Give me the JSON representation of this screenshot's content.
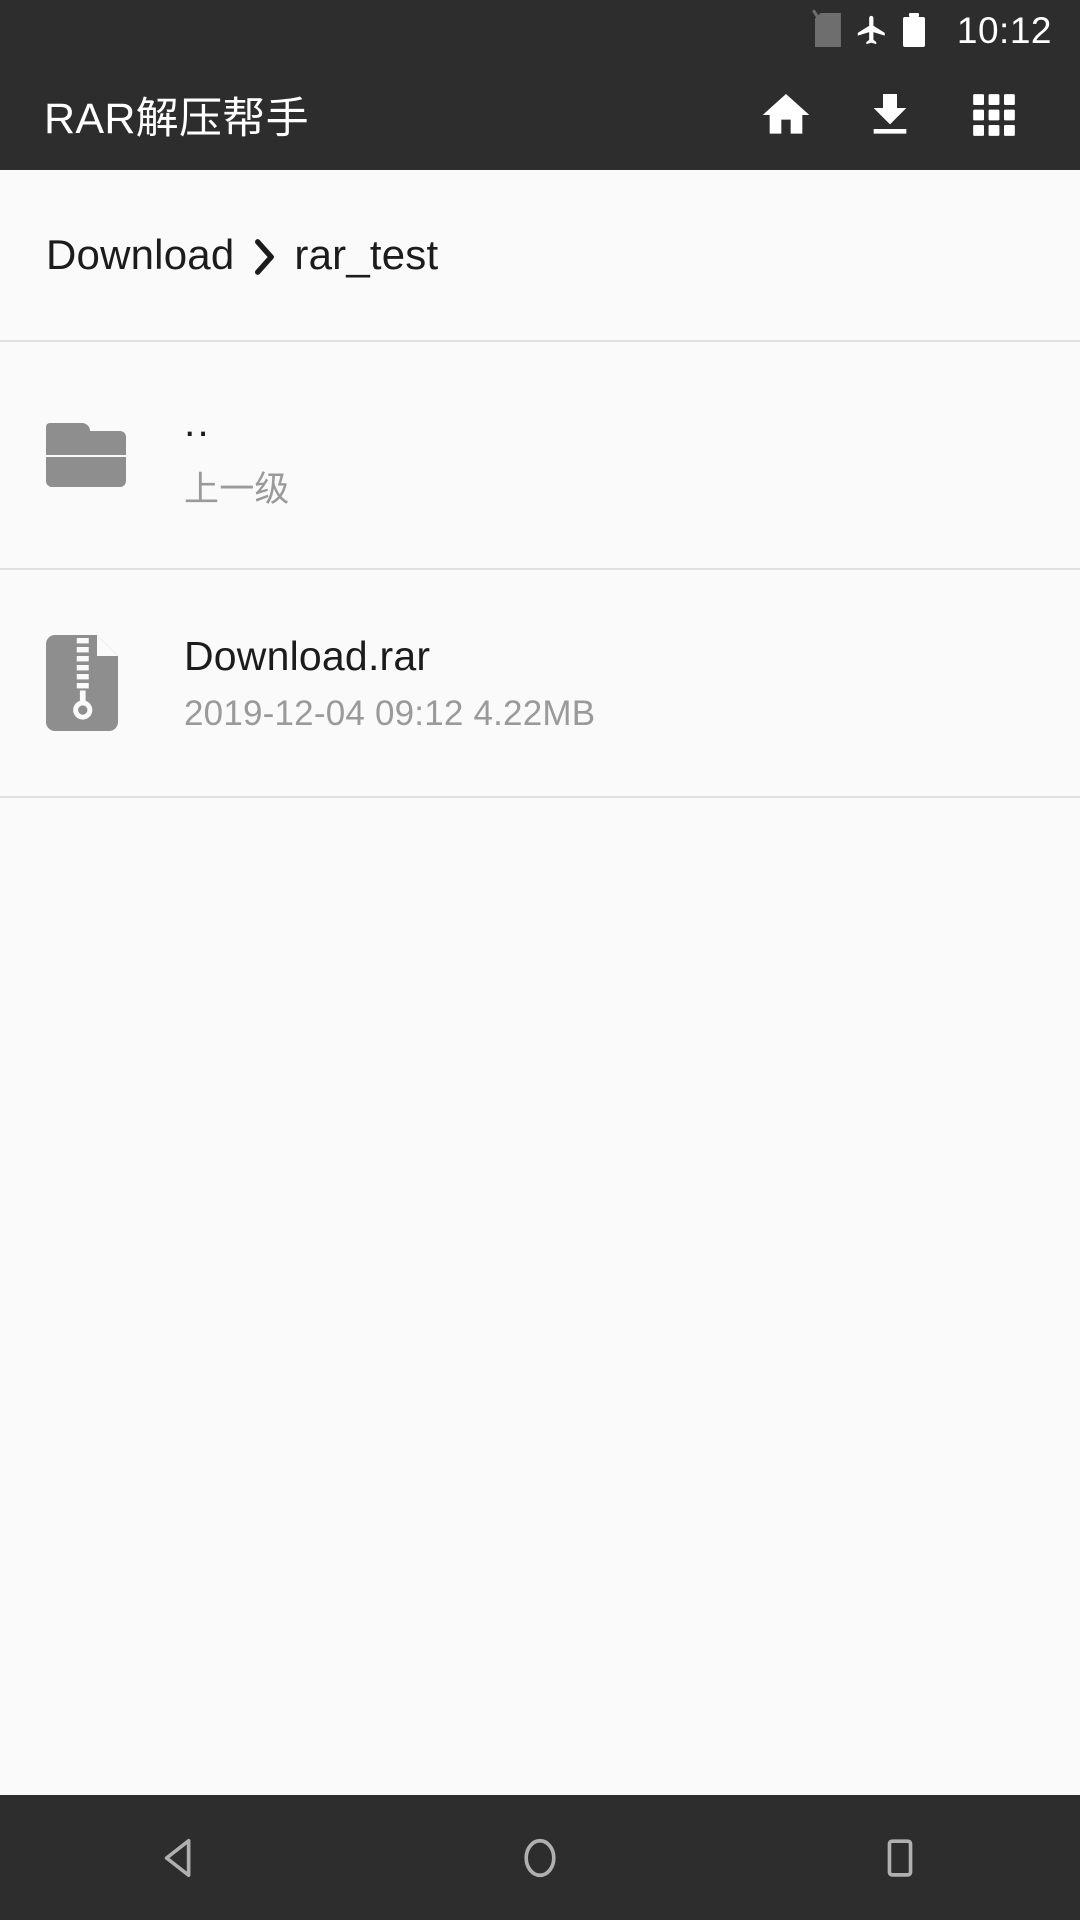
{
  "statusbar": {
    "time": "10:12",
    "icons": [
      {
        "name": "no-sim-icon",
        "label": "no-sim"
      },
      {
        "name": "airplane-mode-icon",
        "label": "airplane-mode"
      },
      {
        "name": "battery-icon",
        "label": "battery-full"
      }
    ]
  },
  "appbar": {
    "title": "RAR解压帮手",
    "actions": [
      {
        "name": "home-icon",
        "label": "home"
      },
      {
        "name": "download-icon",
        "label": "download"
      },
      {
        "name": "apps-grid-icon",
        "label": "apps"
      }
    ]
  },
  "breadcrumb": {
    "separator": "›",
    "items": [
      {
        "label": "Download"
      },
      {
        "label": "rar_test"
      }
    ]
  },
  "file_list": [
    {
      "icon": "folder-icon",
      "title": "..",
      "subtitle": "上一级",
      "type": "folder"
    },
    {
      "icon": "archive-rar-icon",
      "title": "Download.rar",
      "subtitle": "2019-12-04 09:12  4.22MB",
      "type": "file",
      "date": "2019-12-04 09:12",
      "size": "4.22MB"
    }
  ],
  "navbar": {
    "buttons": [
      {
        "name": "nav-back-button",
        "label": "back"
      },
      {
        "name": "nav-home-button",
        "label": "home"
      },
      {
        "name": "nav-recents-button",
        "label": "recents"
      }
    ]
  },
  "colors": {
    "appbar_bg": "#2d2d2d",
    "page_bg": "#fafafa",
    "divider": "#e0e0e0",
    "primary_text": "#1c1c1c",
    "secondary_text": "#9a9a9a",
    "icon_gray": "#8e8e8e",
    "nav_icon": "#b0b0b0"
  }
}
